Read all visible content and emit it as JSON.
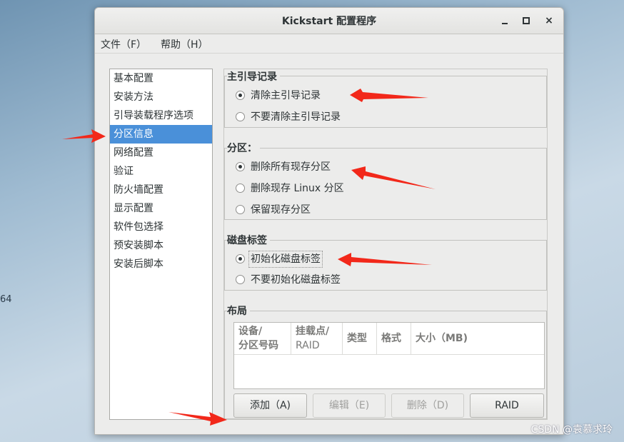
{
  "desktop": {
    "fragment_text": "64",
    "watermark": "CSDN @袁慕求玲"
  },
  "window": {
    "title": "Kickstart 配置程序",
    "controls": {
      "minimize": "minimize",
      "maximize": "maximize",
      "close": "×"
    }
  },
  "menubar": {
    "file": "文件（F）",
    "help": "帮助（H）"
  },
  "sidebar": {
    "items": [
      {
        "label": "基本配置"
      },
      {
        "label": "安装方法"
      },
      {
        "label": "引导装载程序选项"
      },
      {
        "label": "分区信息",
        "selected": true
      },
      {
        "label": "网络配置"
      },
      {
        "label": "验证"
      },
      {
        "label": "防火墙配置"
      },
      {
        "label": "显示配置"
      },
      {
        "label": "软件包选择"
      },
      {
        "label": "预安装脚本"
      },
      {
        "label": "安装后脚本"
      }
    ]
  },
  "mbr": {
    "title": "主引导记录",
    "options": [
      {
        "label": "清除主引导记录",
        "checked": true
      },
      {
        "label": "不要清除主引导记录",
        "checked": false
      }
    ]
  },
  "partition": {
    "title": "分区：",
    "options": [
      {
        "label": "删除所有现存分区",
        "checked": true
      },
      {
        "label": "删除现存 Linux 分区",
        "checked": false
      },
      {
        "label": "保留现存分区",
        "checked": false
      }
    ]
  },
  "disklabel": {
    "title": "磁盘标签",
    "options": [
      {
        "label": "初始化磁盘标签",
        "checked": true
      },
      {
        "label": "不要初始化磁盘标签",
        "checked": false
      }
    ]
  },
  "layout": {
    "title": "布局",
    "columns": [
      {
        "line1": "设备/",
        "line2": "分区号码"
      },
      {
        "line1": "挂载点/",
        "line2": "RAID"
      },
      {
        "line1": "类型"
      },
      {
        "line1": "格式"
      },
      {
        "line1": "大小（MB)"
      }
    ],
    "rows": []
  },
  "buttons": {
    "add": "添加（A)",
    "edit": "编辑（E)",
    "delete": "删除（D)",
    "raid": "RAID"
  },
  "annotation_color": "#f2281a"
}
